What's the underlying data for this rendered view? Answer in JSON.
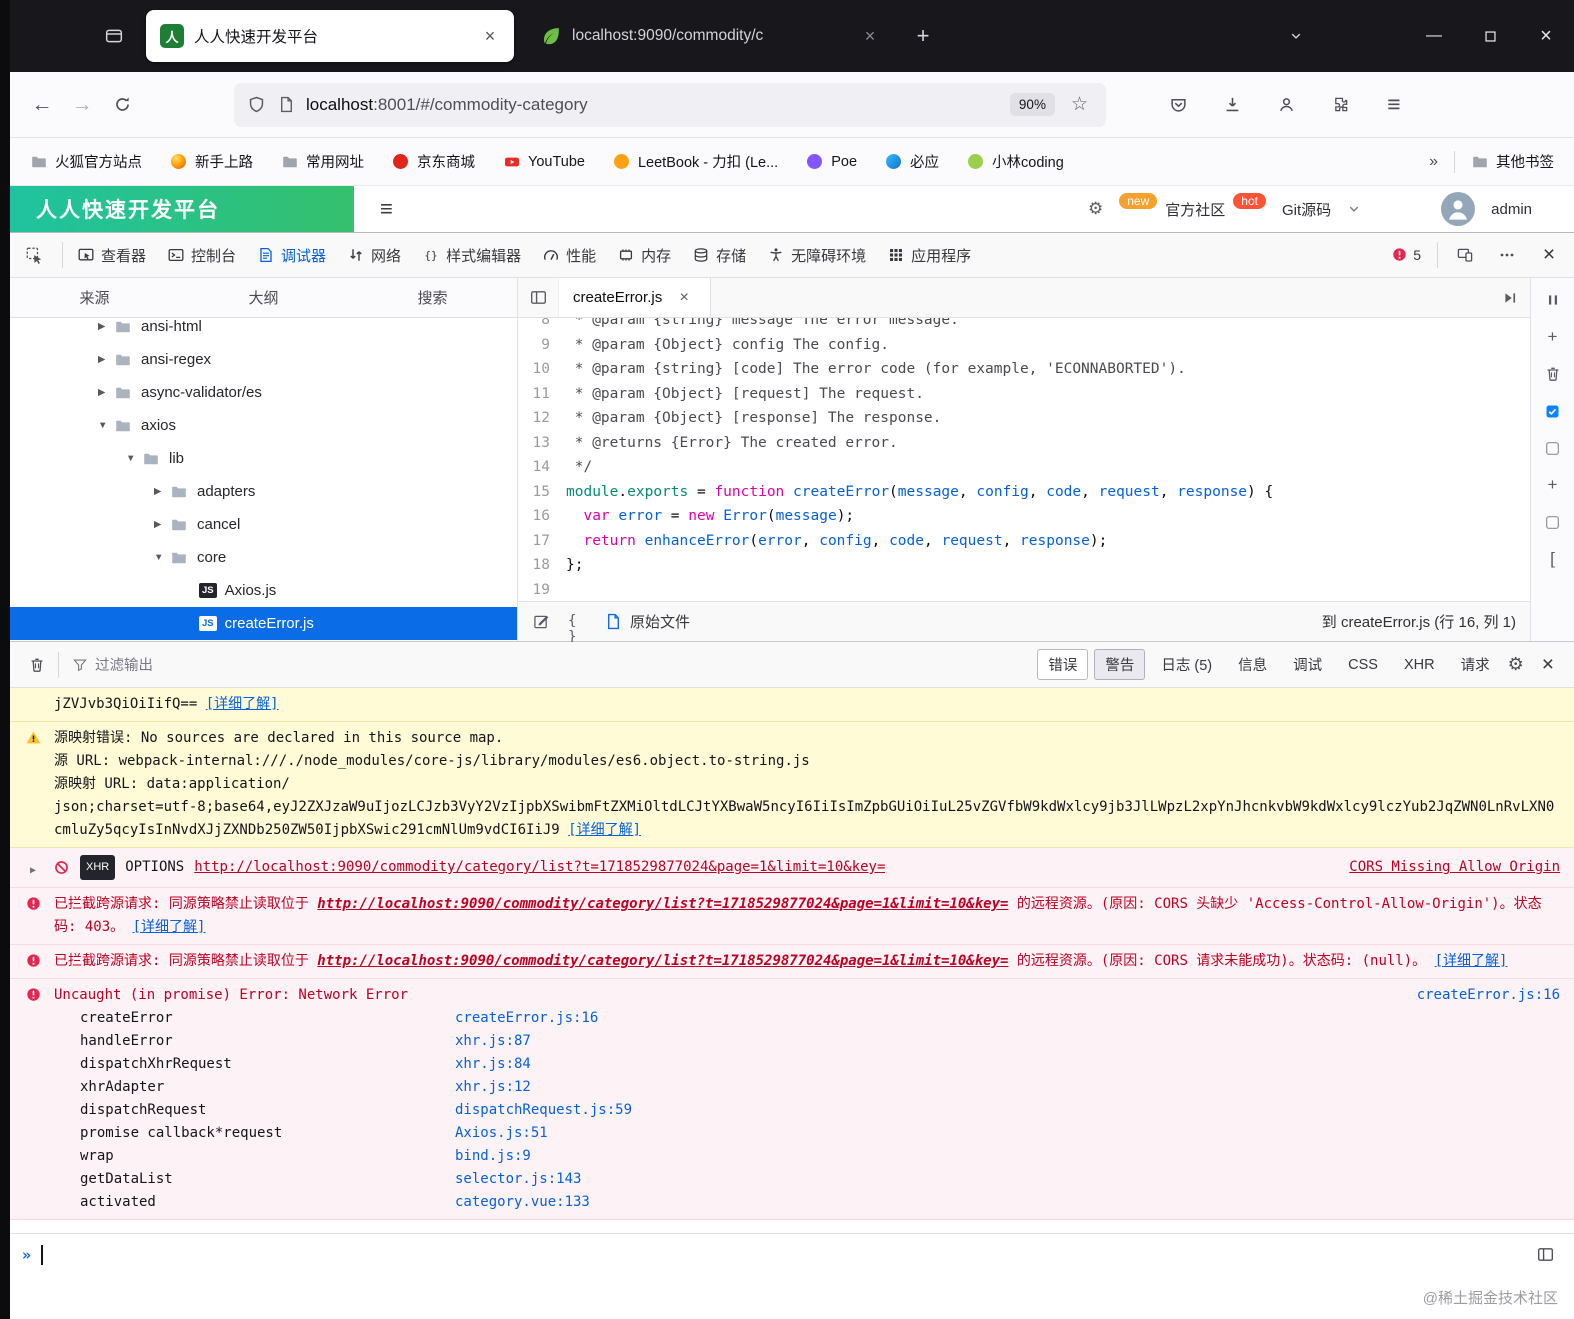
{
  "browser": {
    "tabs": [
      {
        "title": "人人快速开发平台"
      },
      {
        "title": "localhost:9090/commodity/c"
      }
    ],
    "url": {
      "host": "localhost",
      "rest": ":8001/#/commodity-category"
    },
    "zoom": "90%",
    "bookmarks": [
      {
        "label": "火狐官方站点",
        "icon": "folder"
      },
      {
        "label": "新手上路",
        "icon": "firefox"
      },
      {
        "label": "常用网址",
        "icon": "folder"
      },
      {
        "label": "京东商城",
        "icon": "jd"
      },
      {
        "label": "YouTube",
        "icon": "youtube"
      },
      {
        "label": "LeetBook - 力扣 (Le...",
        "icon": "leetbook"
      },
      {
        "label": "Poe",
        "icon": "poe"
      },
      {
        "label": "必应",
        "icon": "bing"
      },
      {
        "label": "小林coding",
        "icon": "xiaolin"
      }
    ],
    "other_bookmarks": "其他书签"
  },
  "page": {
    "brand": "人人快速开发平台",
    "new_badge": "new",
    "community": "官方社区",
    "hot_badge": "hot",
    "git_link": "Git源码",
    "username": "admin"
  },
  "devtools": {
    "tools": [
      {
        "id": "inspector",
        "label": "查看器"
      },
      {
        "id": "console",
        "label": "控制台"
      },
      {
        "id": "debugger",
        "label": "调试器",
        "active": true
      },
      {
        "id": "network",
        "label": "网络"
      },
      {
        "id": "styles",
        "label": "样式编辑器"
      },
      {
        "id": "performance",
        "label": "性能"
      },
      {
        "id": "memory",
        "label": "内存"
      },
      {
        "id": "storage",
        "label": "存储"
      },
      {
        "id": "accessibility",
        "label": "无障碍环境"
      },
      {
        "id": "application",
        "label": "应用程序"
      }
    ],
    "error_count": "5"
  },
  "debugger": {
    "panel_tabs": [
      "来源",
      "大纲",
      "搜索"
    ],
    "editor_tab": "createError.js",
    "tree": [
      {
        "label": "ansi-html",
        "depth": 1,
        "kind": "folder",
        "state": "collapsed"
      },
      {
        "label": "ansi-regex",
        "depth": 1,
        "kind": "folder",
        "state": "collapsed"
      },
      {
        "label": "async-validator/es",
        "depth": 1,
        "kind": "folder",
        "state": "collapsed"
      },
      {
        "label": "axios",
        "depth": 1,
        "kind": "folder",
        "state": "expanded"
      },
      {
        "label": "lib",
        "depth": 2,
        "kind": "folder",
        "state": "expanded"
      },
      {
        "label": "adapters",
        "depth": 3,
        "kind": "folder",
        "state": "collapsed"
      },
      {
        "label": "cancel",
        "depth": 3,
        "kind": "folder",
        "state": "collapsed"
      },
      {
        "label": "core",
        "depth": 3,
        "kind": "folder",
        "state": "expanded"
      },
      {
        "label": "Axios.js",
        "depth": 4,
        "kind": "js"
      },
      {
        "label": "createError.js",
        "depth": 4,
        "kind": "js",
        "selected": true
      }
    ],
    "code_lines": [
      {
        "n": "8",
        "tk": [
          [
            "cm",
            " * @param {string} message The error message."
          ]
        ]
      },
      {
        "n": "9",
        "tk": [
          [
            "cm",
            " * @param {Object} config The config."
          ]
        ]
      },
      {
        "n": "10",
        "tk": [
          [
            "cm",
            " * @param {string} [code] The error code (for example, 'ECONNABORTED')."
          ]
        ]
      },
      {
        "n": "11",
        "tk": [
          [
            "cm",
            " * @param {Object} [request] The request."
          ]
        ]
      },
      {
        "n": "12",
        "tk": [
          [
            "cm",
            " * @param {Object} [response] The response."
          ]
        ]
      },
      {
        "n": "13",
        "tk": [
          [
            "cm",
            " * @returns {Error} The created error."
          ]
        ]
      },
      {
        "n": "14",
        "tk": [
          [
            "cm",
            " */"
          ]
        ]
      },
      {
        "n": "15",
        "tk": [
          [
            "gr",
            "module"
          ],
          [
            "pl",
            "."
          ],
          [
            "gr",
            "exports"
          ],
          [
            "pl",
            " = "
          ],
          [
            "kw",
            "function"
          ],
          [
            "pl",
            " "
          ],
          [
            "fn",
            "createError"
          ],
          [
            "pl",
            "("
          ],
          [
            "fn",
            "message"
          ],
          [
            "pl",
            ", "
          ],
          [
            "fn",
            "config"
          ],
          [
            "pl",
            ", "
          ],
          [
            "fn",
            "code"
          ],
          [
            "pl",
            ", "
          ],
          [
            "fn",
            "request"
          ],
          [
            "pl",
            ", "
          ],
          [
            "fn",
            "response"
          ],
          [
            "pl",
            ") {"
          ]
        ]
      },
      {
        "n": "16",
        "tk": [
          [
            "pl",
            "  "
          ],
          [
            "kw",
            "var"
          ],
          [
            "pl",
            " "
          ],
          [
            "fn",
            "error"
          ],
          [
            "pl",
            " = "
          ],
          [
            "kw",
            "new"
          ],
          [
            "pl",
            " "
          ],
          [
            "fn",
            "Error"
          ],
          [
            "pl",
            "("
          ],
          [
            "fn",
            "message"
          ],
          [
            "pl",
            ");"
          ]
        ]
      },
      {
        "n": "17",
        "tk": [
          [
            "pl",
            "  "
          ],
          [
            "kw",
            "return"
          ],
          [
            "pl",
            " "
          ],
          [
            "fn",
            "enhanceError"
          ],
          [
            "pl",
            "("
          ],
          [
            "fn",
            "error"
          ],
          [
            "pl",
            ", "
          ],
          [
            "fn",
            "config"
          ],
          [
            "pl",
            ", "
          ],
          [
            "fn",
            "code"
          ],
          [
            "pl",
            ", "
          ],
          [
            "fn",
            "request"
          ],
          [
            "pl",
            ", "
          ],
          [
            "fn",
            "response"
          ],
          [
            "pl",
            ");"
          ]
        ]
      },
      {
        "n": "18",
        "tk": [
          [
            "pl",
            "};"
          ]
        ]
      },
      {
        "n": "19",
        "tk": []
      }
    ],
    "footer": {
      "source_file": "原始文件",
      "position": "到 createError.js (行 16, 列 1)"
    }
  },
  "console": {
    "filter_placeholder": "过滤输出",
    "prompt": "»",
    "filters": [
      {
        "id": "error",
        "label": "错误",
        "state": "outlined"
      },
      {
        "id": "warning",
        "label": "警告",
        "state": "pressed"
      },
      {
        "id": "log",
        "label": "日志 (5)"
      },
      {
        "id": "info",
        "label": "信息"
      },
      {
        "id": "debug",
        "label": "调试"
      },
      {
        "id": "css",
        "label": "CSS"
      },
      {
        "id": "xhr",
        "label": "XHR"
      },
      {
        "id": "requests",
        "label": "请求"
      }
    ],
    "messages": [
      {
        "kind": "warn",
        "icon": false,
        "lines": [
          "jZVJvb3QiOiIifQ=="
        ],
        "link": "[详细了解]"
      },
      {
        "kind": "warn",
        "icon": true,
        "lines": [
          "源映射错误: No sources are declared in this source map.",
          "源 URL: webpack-internal:///./node_modules/core-js/library/modules/es6.object.to-string.js",
          "源映射 URL: data:application/",
          "json;charset=utf-8;base64,eyJ2ZXJzaW9uIjozLCJzb3VyY2VzIjpbXSwibmFtZXMiOltdLCJtYXBwaW5ncyI6IiIsImZpbGUiOiIuL25vZGVfbW9kdWxlcy9jb3JlLWpzL2xpYnJhcnkvbW9kdWxlcy9lczYub2JqZWN0LnRvLXN0cmluZy5qcyIsInNvdXJjZXNDb250ZW50IjpbXSwic291cmNlUm9vdCI6IiJ9"
        ],
        "link": "[详细了解]"
      },
      {
        "kind": "net",
        "badge": "XHR",
        "method": "OPTIONS",
        "url": "http://localhost:9090/commodity/category/list?t=1718529877024&page=1&limit=10&key=",
        "right": "CORS Missing Allow Origin"
      },
      {
        "kind": "cors",
        "pre": "已拦截跨源请求: 同源策略禁止读取位于 ",
        "url": "http://localhost:9090/commodity/category/list?t=1718529877024&page=1&limit=10&key=",
        "post": " 的远程资源。(原因: CORS 头缺少 'Access-Control-Allow-Origin')。状态码: 403。",
        "link": "[详细了解]"
      },
      {
        "kind": "cors",
        "pre": "已拦截跨源请求: 同源策略禁止读取位于 ",
        "url": "http://localhost:9090/commodity/category/list?t=1718529877024&page=1&limit=10&key=",
        "post": " 的远程资源。(原因: CORS 请求未能成功)。状态码: (null)。",
        "link": "[详细了解]"
      },
      {
        "kind": "stack",
        "title": "Uncaught (in promise) Error: Network Error",
        "right": "createError.js:16",
        "frames": [
          {
            "fn": "createError",
            "loc": "createError.js:16"
          },
          {
            "fn": "handleError",
            "loc": "xhr.js:87"
          },
          {
            "fn": "dispatchXhrRequest",
            "loc": "xhr.js:84"
          },
          {
            "fn": "xhrAdapter",
            "loc": "xhr.js:12"
          },
          {
            "fn": "dispatchRequest",
            "loc": "dispatchRequest.js:59"
          },
          {
            "fn": "promise callback*request",
            "loc": "Axios.js:51"
          },
          {
            "fn": "wrap",
            "loc": "bind.js:9"
          },
          {
            "fn": "getDataList",
            "loc": "selector.js:143"
          },
          {
            "fn": "activated",
            "loc": "category.vue:133"
          }
        ]
      }
    ]
  },
  "watermark": "@稀土掘金技术社区"
}
